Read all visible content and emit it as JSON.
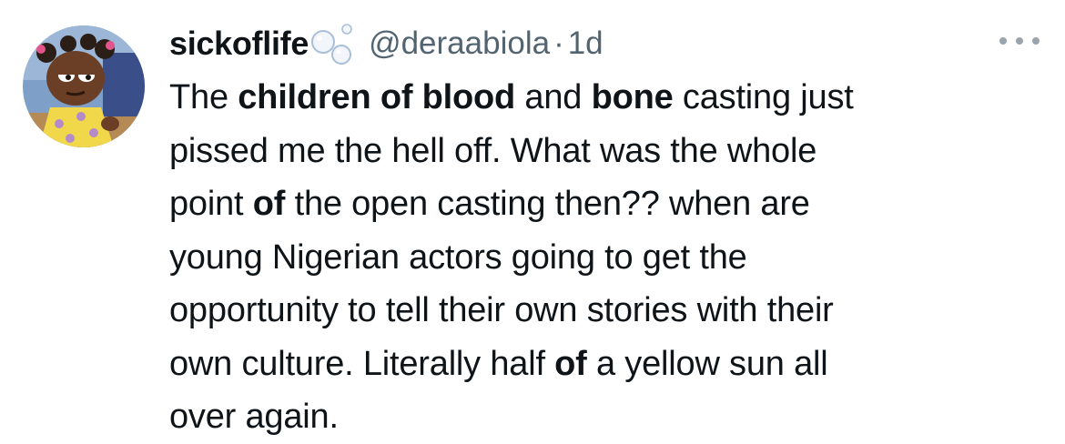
{
  "tweet": {
    "author": {
      "display_name": "sickoflife",
      "handle": "@deraabiola",
      "separator": "·",
      "time": "1d",
      "avatar_icon": "cartoon-character-avatar",
      "name_emoji": "bubbles-emoji"
    },
    "more_icon": "ellipsis-icon",
    "text_lines": [
      [
        {
          "t": "The ",
          "b": false
        },
        {
          "t": "children of blood",
          "b": true
        },
        {
          "t": " and ",
          "b": false
        },
        {
          "t": "bone",
          "b": true
        },
        {
          "t": " casting just",
          "b": false
        }
      ],
      [
        {
          "t": "pissed me the hell off. What was the whole",
          "b": false
        }
      ],
      [
        {
          "t": "point ",
          "b": false
        },
        {
          "t": "of",
          "b": true
        },
        {
          "t": " the open casting then?? when are",
          "b": false
        }
      ],
      [
        {
          "t": "young Nigerian actors going to get the",
          "b": false
        }
      ],
      [
        {
          "t": "opportunity to tell their own stories with their",
          "b": false
        }
      ],
      [
        {
          "t": "own culture. Literally half ",
          "b": false
        },
        {
          "t": "of",
          "b": true
        },
        {
          "t": " a yellow sun all",
          "b": false
        }
      ],
      [
        {
          "t": "over again.",
          "b": false
        }
      ]
    ]
  },
  "colors": {
    "text": "#0f1419",
    "secondary": "#536471",
    "background": "#ffffff"
  }
}
